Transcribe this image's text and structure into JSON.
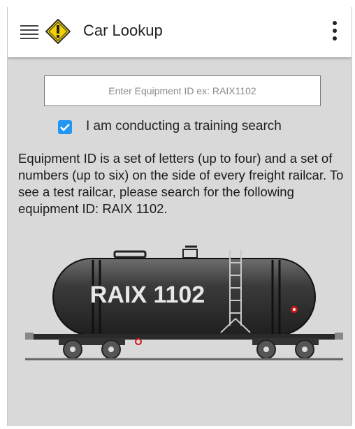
{
  "app": {
    "title": "Car Lookup"
  },
  "icons": {
    "menu": "hamburger-menu-icon",
    "logo": "yellow-diamond-warning-icon",
    "more": "vertical-dots-icon",
    "checkbox": "checkmark-icon"
  },
  "search": {
    "placeholder": "Enter Equipment ID ex: RAIX1102",
    "value": ""
  },
  "training": {
    "label": "I am conducting a training search",
    "checked": true
  },
  "description": "Equipment ID is a set of letters (up to four) and a set of numbers (up to six) on the side of every freight railcar. To see a test railcar, please search for the following equipment ID: RAIX 1102.",
  "railcar": {
    "marking": "RAIX 1102"
  },
  "colors": {
    "accent": "#2196f3",
    "logo_yellow": "#f5d300",
    "background": "#d9d9d9"
  }
}
